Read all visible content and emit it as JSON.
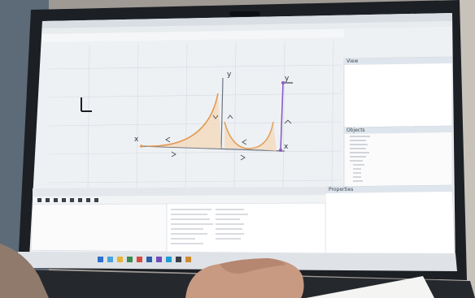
{
  "screen": {
    "plot_labels": {
      "y_axis_left": "y",
      "x_axis_end": "x",
      "y_axis_right": "y",
      "x_axis_right": "x"
    },
    "panels": {
      "right_top_title": "View",
      "right_mid_title": "Objects",
      "right_bottom_title": "Properties"
    }
  }
}
